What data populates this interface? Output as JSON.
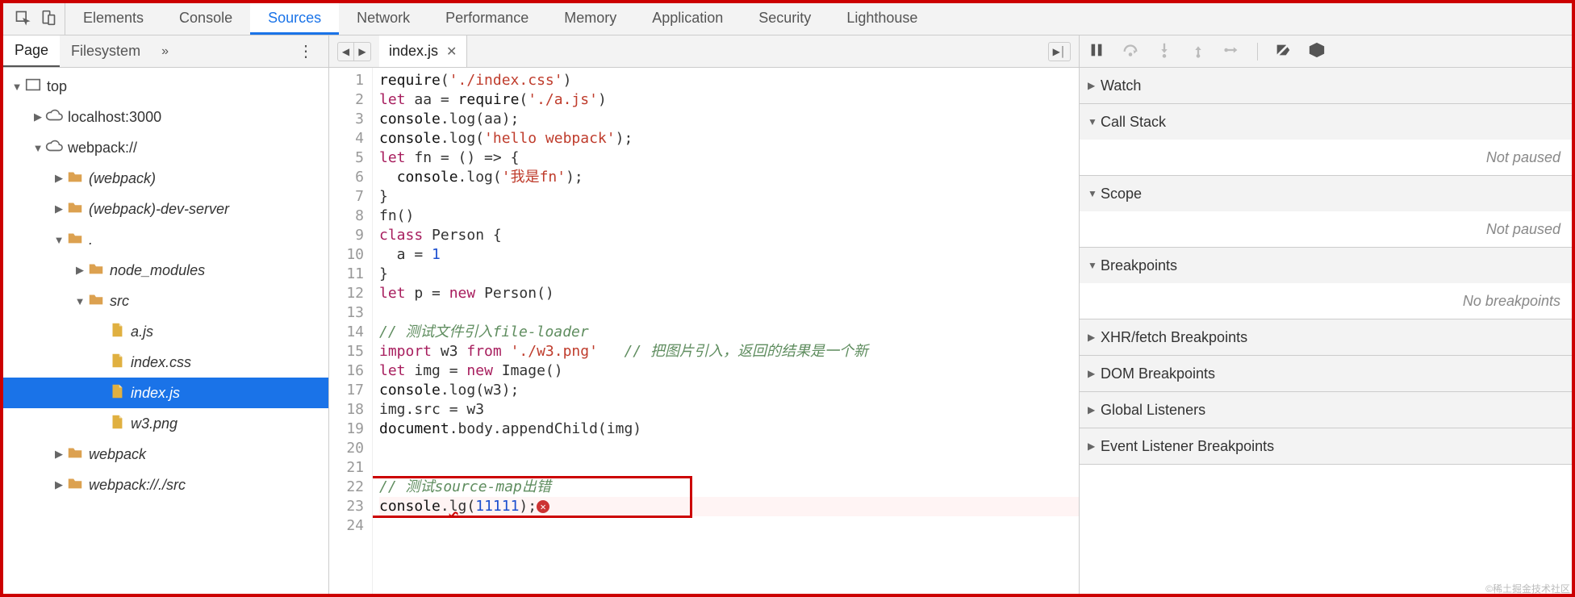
{
  "top_tabs": [
    "Elements",
    "Console",
    "Sources",
    "Network",
    "Performance",
    "Memory",
    "Application",
    "Security",
    "Lighthouse"
  ],
  "top_active_index": 2,
  "left": {
    "subtabs": [
      "Page",
      "Filesystem"
    ],
    "active_index": 0,
    "overflow_glyph": "»"
  },
  "tree": [
    {
      "depth": 0,
      "twisty": "▼",
      "icon": "frame",
      "label": "top",
      "italic": false
    },
    {
      "depth": 1,
      "twisty": "▶",
      "icon": "cloud",
      "label": "localhost:3000",
      "italic": false
    },
    {
      "depth": 1,
      "twisty": "▼",
      "icon": "cloud",
      "label": "webpack://",
      "italic": false
    },
    {
      "depth": 2,
      "twisty": "▶",
      "icon": "folder",
      "label": "(webpack)",
      "italic": true
    },
    {
      "depth": 2,
      "twisty": "▶",
      "icon": "folder",
      "label": "(webpack)-dev-server",
      "italic": true
    },
    {
      "depth": 2,
      "twisty": "▼",
      "icon": "folder",
      "label": ".",
      "italic": true
    },
    {
      "depth": 3,
      "twisty": "▶",
      "icon": "folder",
      "label": "node_modules",
      "italic": true
    },
    {
      "depth": 3,
      "twisty": "▼",
      "icon": "folder",
      "label": "src",
      "italic": true
    },
    {
      "depth": 4,
      "twisty": " ",
      "icon": "file",
      "label": "a.js",
      "italic": true
    },
    {
      "depth": 4,
      "twisty": " ",
      "icon": "file",
      "label": "index.css",
      "italic": true
    },
    {
      "depth": 4,
      "twisty": " ",
      "icon": "file",
      "label": "index.js",
      "italic": true,
      "selected": true
    },
    {
      "depth": 4,
      "twisty": " ",
      "icon": "file",
      "label": "w3.png",
      "italic": true
    },
    {
      "depth": 2,
      "twisty": "▶",
      "icon": "folder",
      "label": "webpack",
      "italic": true
    },
    {
      "depth": 2,
      "twisty": "▶",
      "icon": "folder",
      "label": "webpack://./src",
      "italic": true
    }
  ],
  "editor": {
    "open_file": "index.js",
    "line_count": 24,
    "error_line": 23,
    "lines": [
      [
        {
          "t": "require",
          "c": "c-obj"
        },
        {
          "t": "(",
          "c": ""
        },
        {
          "t": "'./index.css'",
          "c": "c-str"
        },
        {
          "t": ")",
          "c": ""
        }
      ],
      [
        {
          "t": "let ",
          "c": "c-kw"
        },
        {
          "t": "aa = ",
          "c": ""
        },
        {
          "t": "require",
          "c": "c-obj"
        },
        {
          "t": "(",
          "c": ""
        },
        {
          "t": "'./a.js'",
          "c": "c-str"
        },
        {
          "t": ")",
          "c": ""
        }
      ],
      [
        {
          "t": "console",
          "c": "c-obj"
        },
        {
          "t": ".log(aa);",
          "c": ""
        }
      ],
      [
        {
          "t": "console",
          "c": "c-obj"
        },
        {
          "t": ".log(",
          "c": ""
        },
        {
          "t": "'hello webpack'",
          "c": "c-str"
        },
        {
          "t": ");",
          "c": ""
        }
      ],
      [
        {
          "t": "let ",
          "c": "c-kw"
        },
        {
          "t": "fn = () => {",
          "c": ""
        }
      ],
      [
        {
          "t": "  ",
          "c": ""
        },
        {
          "t": "console",
          "c": "c-obj"
        },
        {
          "t": ".log(",
          "c": ""
        },
        {
          "t": "'我是fn'",
          "c": "c-str"
        },
        {
          "t": ");",
          "c": ""
        }
      ],
      [
        {
          "t": "}",
          "c": ""
        }
      ],
      [
        {
          "t": "fn()",
          "c": ""
        }
      ],
      [
        {
          "t": "class ",
          "c": "c-kw"
        },
        {
          "t": "Person {",
          "c": ""
        }
      ],
      [
        {
          "t": "  a = ",
          "c": ""
        },
        {
          "t": "1",
          "c": "c-num"
        }
      ],
      [
        {
          "t": "}",
          "c": ""
        }
      ],
      [
        {
          "t": "let ",
          "c": "c-kw"
        },
        {
          "t": "p = ",
          "c": ""
        },
        {
          "t": "new ",
          "c": "c-kw"
        },
        {
          "t": "Person()",
          "c": ""
        }
      ],
      [],
      [
        {
          "t": "// 测试文件引入file-loader",
          "c": "c-cm"
        }
      ],
      [
        {
          "t": "import ",
          "c": "c-kw"
        },
        {
          "t": "w3 ",
          "c": ""
        },
        {
          "t": "from ",
          "c": "c-kw"
        },
        {
          "t": "'./w3.png'",
          "c": "c-str"
        },
        {
          "t": "   ",
          "c": ""
        },
        {
          "t": "// 把图片引入，返回的结果是一个新",
          "c": "c-cm"
        }
      ],
      [
        {
          "t": "let ",
          "c": "c-kw"
        },
        {
          "t": "img = ",
          "c": ""
        },
        {
          "t": "new ",
          "c": "c-kw"
        },
        {
          "t": "Image()",
          "c": ""
        }
      ],
      [
        {
          "t": "console",
          "c": "c-obj"
        },
        {
          "t": ".log(w3);",
          "c": ""
        }
      ],
      [
        {
          "t": "img.src = w3",
          "c": ""
        }
      ],
      [
        {
          "t": "document",
          "c": "c-obj"
        },
        {
          "t": ".body.appendChild(img)",
          "c": ""
        }
      ],
      [],
      [],
      [
        {
          "t": "// 测试source-map出错",
          "c": "c-cm"
        }
      ],
      [
        {
          "t": "console",
          "c": "c-obj"
        },
        {
          "t": ".",
          "c": ""
        },
        {
          "t": "lg",
          "c": "err-underline"
        },
        {
          "t": "(",
          "c": ""
        },
        {
          "t": "11111",
          "c": "c-num"
        },
        {
          "t": ");",
          "c": ""
        },
        {
          "t": "ERRDOT",
          "c": "err-dot-marker"
        }
      ],
      []
    ]
  },
  "debugger": {
    "sections": [
      {
        "title": "Watch",
        "expanded": false
      },
      {
        "title": "Call Stack",
        "expanded": true,
        "body": "Not paused"
      },
      {
        "title": "Scope",
        "expanded": true,
        "body": "Not paused"
      },
      {
        "title": "Breakpoints",
        "expanded": true,
        "body": "No breakpoints"
      },
      {
        "title": "XHR/fetch Breakpoints",
        "expanded": false
      },
      {
        "title": "DOM Breakpoints",
        "expanded": false
      },
      {
        "title": "Global Listeners",
        "expanded": false
      },
      {
        "title": "Event Listener Breakpoints",
        "expanded": false
      }
    ]
  },
  "watermark": "©稀土掘金技术社区"
}
